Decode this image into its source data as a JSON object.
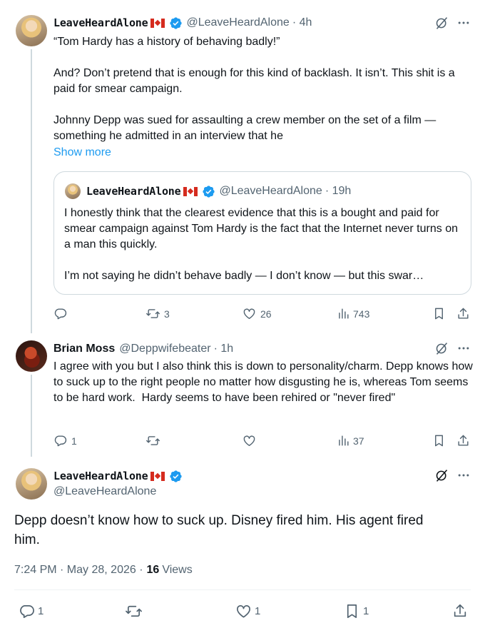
{
  "colors": {
    "accent": "#1d9bf0",
    "muted": "#536471",
    "text": "#0f1419",
    "border": "#cfd9de"
  },
  "tweet1": {
    "display_name": "LeaveHeardAlone",
    "handle": "@LeaveHeardAlone",
    "time": "· 4h",
    "body": "“Tom Hardy has a history of behaving badly!”\n\nAnd? Don’t pretend that is enough for this kind of backlash. It isn’t. This shit is a paid for smear campaign.\n\nJohnny Depp was sued for assaulting a crew member on the set of a film — something he admitted in an interview that he",
    "show_more": "Show more",
    "quote": {
      "display_name": "LeaveHeardAlone",
      "handle": "@LeaveHeardAlone",
      "time": "· 19h",
      "body": "I honestly think that the clearest evidence that this is a bought and paid for smear campaign against Tom Hardy is the fact that the Internet never turns on a man this quickly.\n\nI’m not saying he didn’t behave badly — I don’t know — but this swar…"
    },
    "actions": {
      "replies": "",
      "reposts": "3",
      "likes": "26",
      "views": "743"
    }
  },
  "tweet2": {
    "display_name": "Brian Moss",
    "handle": "@Deppwifebeater",
    "time": "· 1h",
    "body": "I agree with you but I also think this is down to personality/charm. Depp knows how to suck up to the right people no matter how disgusting he is, whereas Tom seems to be hard work.  Hardy seems to have been rehired or \"never fired\"",
    "actions": {
      "replies": "1",
      "reposts": "",
      "likes": "",
      "views": "37"
    }
  },
  "main": {
    "display_name": "LeaveHeardAlone",
    "handle": "@LeaveHeardAlone",
    "body": "Depp doesn’t know how to suck up. Disney fired him. His agent fired him.",
    "timestamp": "7:24 PM · May 28, 2026 ·",
    "views_count": "16",
    "views_label": "Views",
    "actions": {
      "replies": "1",
      "reposts": "",
      "likes": "1",
      "bookmarks": "1"
    }
  },
  "icons": [
    "grok-icon",
    "more-icon",
    "reply-icon",
    "repost-icon",
    "like-icon",
    "views-icon",
    "bookmark-icon",
    "share-icon",
    "verified-badge-icon",
    "canada-flag-icon"
  ]
}
